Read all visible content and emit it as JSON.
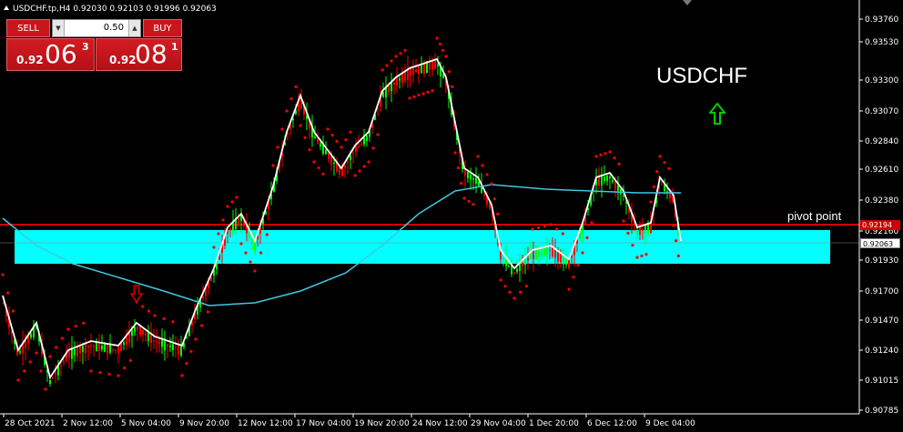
{
  "header": {
    "symbol_info": "USDCHF.tp,H4  0.92030 0.92103 0.91996 0.92063"
  },
  "trade_panel": {
    "sell_label": "SELL",
    "buy_label": "BUY",
    "lot_value": "0.50",
    "sell_price": {
      "small": "0.92",
      "big": "06",
      "sup": "3"
    },
    "buy_price": {
      "small": "0.92",
      "big": "08",
      "sup": "1"
    }
  },
  "annotations": {
    "symbol_title": "USDCHF",
    "pivot_label": "pivot point",
    "pivot_price_tag": "0.92194",
    "bid_price_tag": "0.92063"
  },
  "price_axis": [
    "0.93760",
    "0.93530",
    "0.93300",
    "0.93070",
    "0.92840",
    "0.92610",
    "0.92380",
    "0.92160",
    "0.91930",
    "0.91700",
    "0.91470",
    "0.91240",
    "0.91015",
    "0.90785"
  ],
  "time_axis": [
    "28 Oct 2021",
    "2 Nov 12:00",
    "5 Nov 04:00",
    "9 Nov 20:00",
    "12 Nov 12:00",
    "17 Nov 04:00",
    "19 Nov 20:00",
    "24 Nov 12:00",
    "29 Nov 04:00",
    "1 Dec 20:00",
    "6 Dec 12:00",
    "9 Dec 04:00"
  ],
  "colors": {
    "background": "#000000",
    "bull_candle": "#00ff00",
    "bear_candle": "#ff0000",
    "sar_dots": "#ff0000",
    "fast_ma": "#ffffff",
    "slow_ma": "#3ec9e0",
    "pivot_line": "#d10000",
    "zone": "#00ffff",
    "up_arrow": "#00cc00",
    "down_arrow": "#cc0000"
  },
  "icons": {
    "up_signal": "up-arrow-icon",
    "down_signal": "down-arrow-icon"
  }
}
